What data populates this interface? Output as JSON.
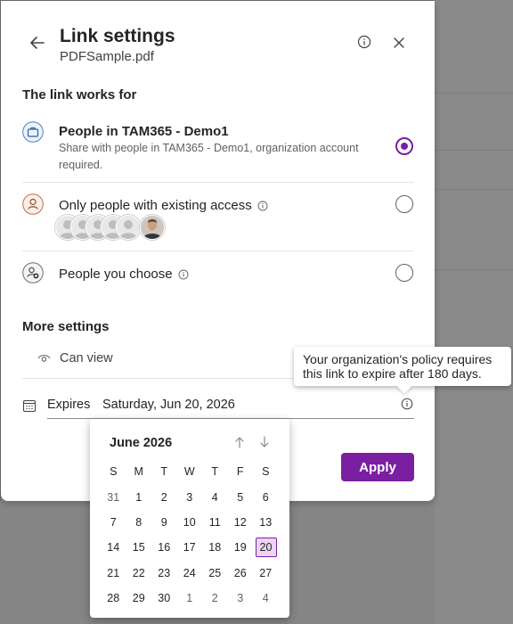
{
  "dialog": {
    "title": "Link settings",
    "subtitle": "PDFSample.pdf"
  },
  "link_works_for": {
    "label": "The link works for",
    "options": [
      {
        "title": "People in TAM365 - Demo1",
        "description": "Share with people in TAM365 - Demo1, organization account required.",
        "selected": true,
        "icon": "briefcase-icon"
      },
      {
        "title": "Only people with existing access",
        "description": "",
        "selected": false,
        "icon": "person-icon"
      },
      {
        "title": "People you choose",
        "description": "",
        "selected": false,
        "icon": "people-add-icon"
      }
    ]
  },
  "more_settings": {
    "label": "More settings",
    "permission": "Can view",
    "expires_label": "Expires",
    "expires_value": "Saturday, Jun 20, 2026"
  },
  "tooltip": "Your organization's policy requires this link to expire after 180 days.",
  "apply_label": "Apply",
  "calendar": {
    "month": "June 2026",
    "weekdays": [
      "S",
      "M",
      "T",
      "W",
      "T",
      "F",
      "S"
    ],
    "weeks": [
      [
        "31",
        "1",
        "2",
        "3",
        "4",
        "5",
        "6"
      ],
      [
        "7",
        "8",
        "9",
        "10",
        "11",
        "12",
        "13"
      ],
      [
        "14",
        "15",
        "16",
        "17",
        "18",
        "19",
        "20"
      ],
      [
        "21",
        "22",
        "23",
        "24",
        "25",
        "26",
        "27"
      ],
      [
        "28",
        "29",
        "30",
        "1",
        "2",
        "3",
        "4"
      ]
    ],
    "selected": "20"
  },
  "colors": {
    "accent": "#7b1fa2",
    "selected_day_bg": "#ead4f2"
  }
}
